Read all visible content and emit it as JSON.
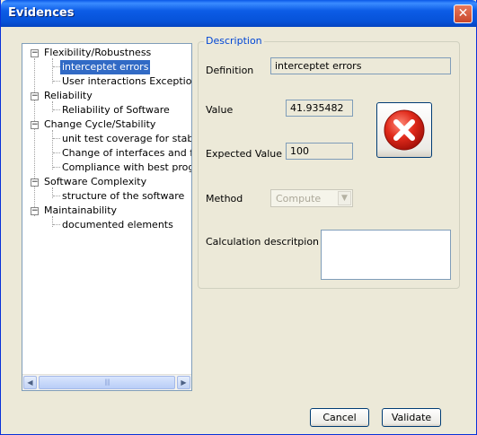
{
  "window": {
    "title": "Evidences",
    "close_glyph": "✕"
  },
  "tree": {
    "nodes": [
      {
        "label": "Flexibility/Robustness",
        "expander": "−"
      },
      {
        "label": "interceptet errors"
      },
      {
        "label": "User interactions Exceptions"
      },
      {
        "label": "Reliability",
        "expander": "−"
      },
      {
        "label": "Reliability of Software"
      },
      {
        "label": "Change Cycle/Stability",
        "expander": "−"
      },
      {
        "label": "unit test coverage for stability"
      },
      {
        "label": "Change of interfaces and functions"
      },
      {
        "label": "Compliance with best programming practices"
      },
      {
        "label": "Software Complexity",
        "expander": "−"
      },
      {
        "label": "structure of the software"
      },
      {
        "label": "Maintainability",
        "expander": "−"
      },
      {
        "label": "documented elements"
      }
    ],
    "scroll_left": "◀",
    "scroll_right": "▶",
    "thumb_grip": "||||"
  },
  "description": {
    "legend": "Description",
    "definition_label": "Definition",
    "definition_value": "interceptet errors",
    "value_label": "Value",
    "value": "41.935482",
    "expected_label": "Expected Value",
    "expected_value": "100",
    "method_label": "Method",
    "method_value": "Compute",
    "method_arrow": "▼",
    "calc_label": "Calculation descritpion",
    "calc_value": "",
    "status_icon": "error-x-icon",
    "status_color": "#e02a1b"
  },
  "buttons": {
    "cancel": "Cancel",
    "validate": "Validate"
  }
}
